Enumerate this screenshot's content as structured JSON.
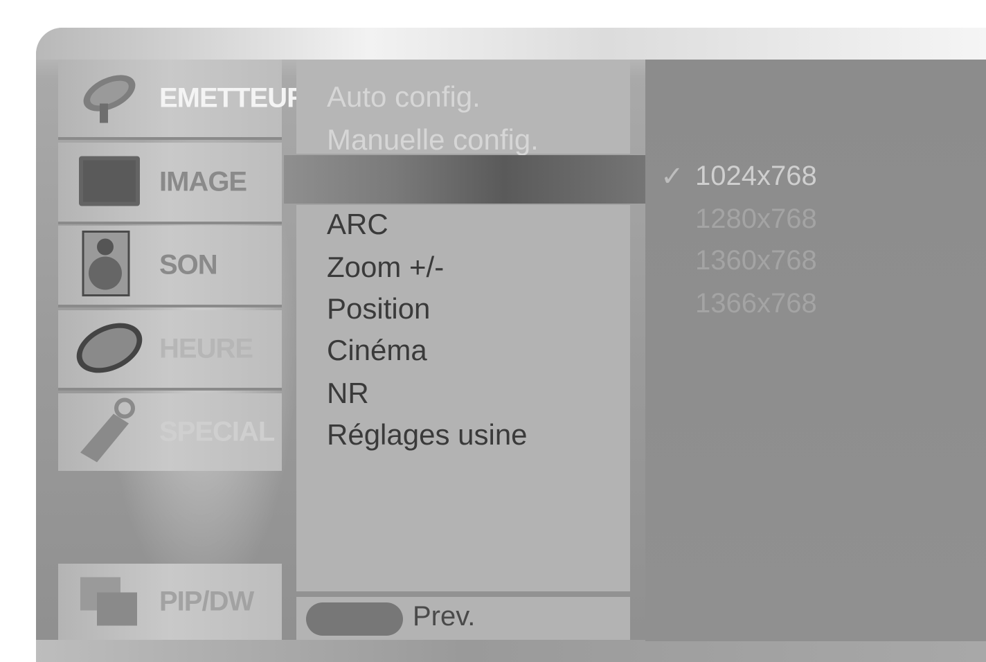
{
  "sidebar": {
    "items": [
      {
        "label": "EMETTEUR",
        "icon": "satellite-dish-icon"
      },
      {
        "label": "IMAGE",
        "icon": "tv-screen-icon"
      },
      {
        "label": "SON",
        "icon": "speaker-icon"
      },
      {
        "label": "HEURE",
        "icon": "clock-icon"
      },
      {
        "label": "SPECIAL",
        "icon": "key-tag-icon"
      }
    ],
    "bottom_item": {
      "label": "PIP/DW",
      "icon": "pip-screens-icon"
    }
  },
  "menu": {
    "top_items": [
      "Auto config.",
      "Manuelle config."
    ],
    "items": [
      "ARC",
      "Zoom +/-",
      "Position",
      "Cinéma",
      "NR",
      "Réglages usine"
    ]
  },
  "submenu": {
    "check": "✓",
    "options": [
      "1024x768",
      "1280x768",
      "1360x768",
      "1366x768"
    ]
  },
  "footer": {
    "prev_label": "Prev."
  },
  "colors": {
    "frame": "#9b9b9b",
    "panel": "#b3b3b3",
    "right_panel": "#8c8c8c",
    "text": "#3a3a3a"
  }
}
